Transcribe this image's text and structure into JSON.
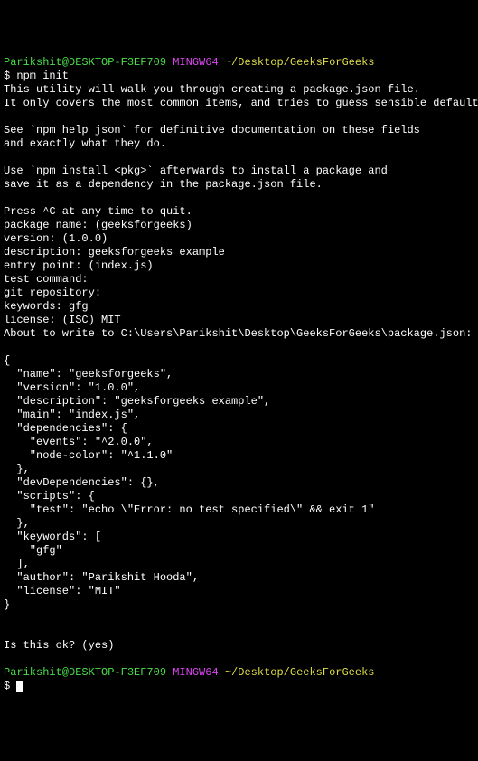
{
  "prompt1": {
    "user": "Parikshit@DESKTOP-F3EF709",
    "host": "MINGW64",
    "path": "~/Desktop/GeeksForGeeks"
  },
  "cmd1": "$ npm init",
  "intro1": "This utility will walk you through creating a package.json file.",
  "intro2": "It only covers the most common items, and tries to guess sensible defaults.",
  "intro3": "See `npm help json` for definitive documentation on these fields",
  "intro4": "and exactly what they do.",
  "intro5": "Use `npm install <pkg>` afterwards to install a package and",
  "intro6": "save it as a dependency in the package.json file.",
  "intro7": "Press ^C at any time to quit.",
  "q_name": "package name: (geeksforgeeks)",
  "q_version": "version: (1.0.0)",
  "q_desc": "description: geeksforgeeks example",
  "q_entry": "entry point: (index.js)",
  "q_test": "test command:",
  "q_git": "git repository:",
  "q_keywords": "keywords: gfg",
  "q_license": "license: (ISC) MIT",
  "about": "About to write to C:\\Users\\Parikshit\\Desktop\\GeeksForGeeks\\package.json:",
  "j_open": "{",
  "j_name": "  \"name\": \"geeksforgeeks\",",
  "j_version": "  \"version\": \"1.0.0\",",
  "j_desc": "  \"description\": \"geeksforgeeks example\",",
  "j_main": "  \"main\": \"index.js\",",
  "j_deps": "  \"dependencies\": {",
  "j_events": "    \"events\": \"^2.0.0\",",
  "j_nodecolor": "    \"node-color\": \"^1.1.0\"",
  "j_deps_close": "  },",
  "j_devdeps": "  \"devDependencies\": {},",
  "j_scripts": "  \"scripts\": {",
  "j_test": "    \"test\": \"echo \\\"Error: no test specified\\\" && exit 1\"",
  "j_scripts_close": "  },",
  "j_keywords": "  \"keywords\": [",
  "j_gfg": "    \"gfg\"",
  "j_keywords_close": "  ],",
  "j_author": "  \"author\": \"Parikshit Hooda\",",
  "j_license": "  \"license\": \"MIT\"",
  "j_close": "}",
  "confirm": "Is this ok? (yes)",
  "prompt2": {
    "user": "Parikshit@DESKTOP-F3EF709",
    "host": "MINGW64",
    "path": "~/Desktop/GeeksForGeeks"
  },
  "cmd2": "$ "
}
